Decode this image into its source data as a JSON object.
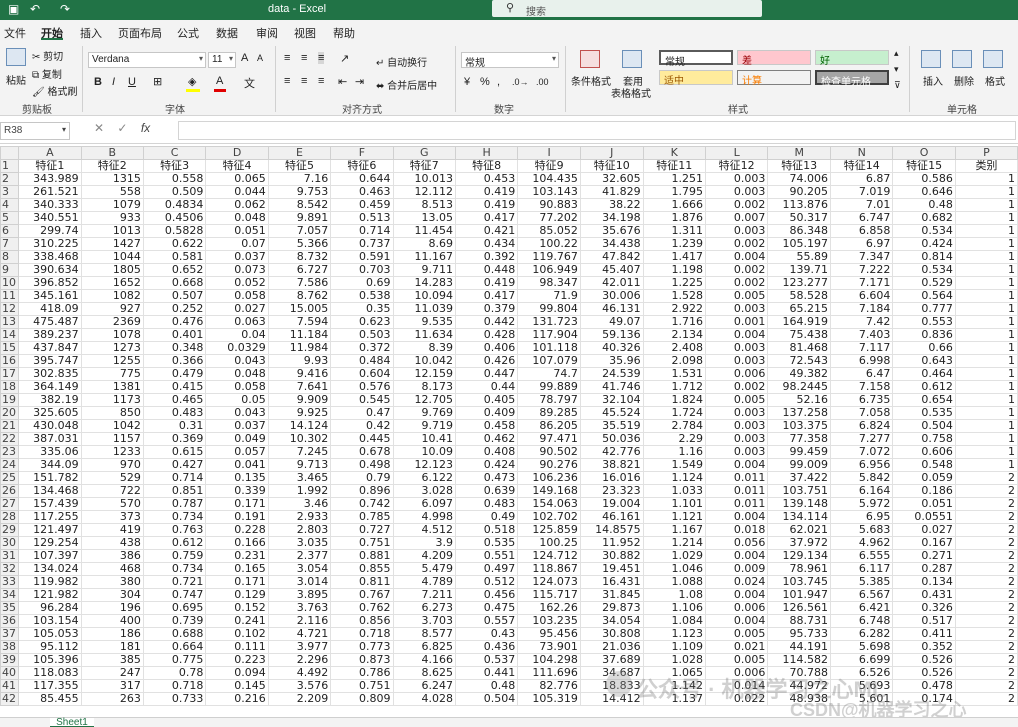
{
  "titlebar": {
    "title": "data  -  Excel",
    "search_placeholder": "搜索",
    "undo": "↶",
    "redo": "↷",
    "save": "▣"
  },
  "tabs": [
    "文件",
    "开始",
    "插入",
    "页面布局",
    "公式",
    "数据",
    "审阅",
    "视图",
    "帮助"
  ],
  "ribbon": {
    "paste": "粘贴",
    "cut": "剪切",
    "copy": "复制",
    "format_painter": "格式刷",
    "clipboard": "剪贴板",
    "font_name": "Verdana",
    "font_size": "11",
    "font_group": "字体",
    "bold": "B",
    "italic": "I",
    "underline": "U",
    "wrap": "自动换行",
    "merge": "合并后居中",
    "align_group": "对齐方式",
    "number_format": "常规",
    "percent": "%",
    "comma": ",",
    "number_group": "数字",
    "cond_format": "条件格式",
    "table_format_1": "套用",
    "table_format_2": "表格格式",
    "styles": {
      "normal": "常规",
      "bad": "差",
      "good": "好",
      "neutral": "适中",
      "calc": "计算",
      "check": "检查单元格"
    },
    "styles_group": "样式",
    "insert": "插入",
    "delete": "删除",
    "format": "格式",
    "cells_group": "单元格"
  },
  "formula": {
    "name_box": "R38",
    "fx": "fx",
    "cancel": "✕",
    "enter": "✓"
  },
  "columns": [
    "A",
    "B",
    "C",
    "D",
    "E",
    "F",
    "G",
    "H",
    "I",
    "J",
    "K",
    "L",
    "M",
    "N",
    "O",
    "P"
  ],
  "header_row": [
    "特征1",
    "特征2",
    "特征3",
    "特征4",
    "特征5",
    "特征6",
    "特征7",
    "特征8",
    "特征9",
    "特征10",
    "特征11",
    "特征12",
    "特征13",
    "特征14",
    "特征15",
    "类别"
  ],
  "rows": [
    [
      "343.989",
      "1315",
      "0.558",
      "0.065",
      "7.16",
      "0.644",
      "10.013",
      "0.453",
      "104.435",
      "32.605",
      "1.251",
      "0.003",
      "74.006",
      "6.87",
      "0.586",
      "1"
    ],
    [
      "261.521",
      "558",
      "0.509",
      "0.044",
      "9.753",
      "0.463",
      "12.112",
      "0.419",
      "103.143",
      "41.829",
      "1.795",
      "0.003",
      "90.205",
      "7.019",
      "0.646",
      "1"
    ],
    [
      "340.333",
      "1079",
      "0.4834",
      "0.062",
      "8.542",
      "0.459",
      "8.513",
      "0.419",
      "90.883",
      "38.22",
      "1.666",
      "0.002",
      "113.876",
      "7.01",
      "0.48",
      "1"
    ],
    [
      "340.551",
      "933",
      "0.4506",
      "0.048",
      "9.891",
      "0.513",
      "13.05",
      "0.417",
      "77.202",
      "34.198",
      "1.876",
      "0.007",
      "50.317",
      "6.747",
      "0.682",
      "1"
    ],
    [
      "299.74",
      "1013",
      "0.5828",
      "0.051",
      "7.057",
      "0.714",
      "11.454",
      "0.421",
      "85.052",
      "35.676",
      "1.311",
      "0.003",
      "86.348",
      "6.858",
      "0.534",
      "1"
    ],
    [
      "310.225",
      "1427",
      "0.622",
      "0.07",
      "5.366",
      "0.737",
      "8.69",
      "0.434",
      "100.22",
      "34.438",
      "1.239",
      "0.002",
      "105.197",
      "6.97",
      "0.424",
      "1"
    ],
    [
      "338.468",
      "1044",
      "0.581",
      "0.037",
      "8.732",
      "0.591",
      "11.167",
      "0.392",
      "119.767",
      "47.842",
      "1.417",
      "0.004",
      "55.89",
      "7.347",
      "0.814",
      "1"
    ],
    [
      "390.634",
      "1805",
      "0.652",
      "0.073",
      "6.727",
      "0.703",
      "9.711",
      "0.448",
      "106.949",
      "45.407",
      "1.198",
      "0.002",
      "139.71",
      "7.222",
      "0.534",
      "1"
    ],
    [
      "396.852",
      "1652",
      "0.668",
      "0.052",
      "7.586",
      "0.69",
      "14.283",
      "0.419",
      "98.347",
      "42.011",
      "1.225",
      "0.002",
      "123.277",
      "7.171",
      "0.529",
      "1"
    ],
    [
      "345.161",
      "1082",
      "0.507",
      "0.058",
      "8.762",
      "0.538",
      "10.094",
      "0.417",
      "71.9",
      "30.006",
      "1.528",
      "0.005",
      "58.528",
      "6.604",
      "0.564",
      "1"
    ],
    [
      "418.09",
      "927",
      "0.252",
      "0.027",
      "15.005",
      "0.35",
      "11.039",
      "0.379",
      "99.804",
      "46.131",
      "2.922",
      "0.003",
      "65.215",
      "7.184",
      "0.777",
      "1"
    ],
    [
      "475.487",
      "2369",
      "0.476",
      "0.063",
      "7.594",
      "0.623",
      "9.535",
      "0.442",
      "131.723",
      "49.07",
      "1.716",
      "0.001",
      "164.919",
      "7.42",
      "0.553",
      "1"
    ],
    [
      "389.237",
      "1078",
      "0.401",
      "0.04",
      "11.184",
      "0.503",
      "11.634",
      "0.428",
      "117.904",
      "59.136",
      "2.134",
      "0.004",
      "75.438",
      "7.403",
      "0.836",
      "1"
    ],
    [
      "437.847",
      "1273",
      "0.348",
      "0.0329",
      "11.984",
      "0.372",
      "8.39",
      "0.406",
      "101.118",
      "40.326",
      "2.408",
      "0.003",
      "81.468",
      "7.117",
      "0.66",
      "1"
    ],
    [
      "395.747",
      "1255",
      "0.366",
      "0.043",
      "9.93",
      "0.484",
      "10.042",
      "0.426",
      "107.079",
      "35.96",
      "2.098",
      "0.003",
      "72.543",
      "6.998",
      "0.643",
      "1"
    ],
    [
      "302.835",
      "775",
      "0.479",
      "0.048",
      "9.416",
      "0.604",
      "12.159",
      "0.447",
      "74.7",
      "24.539",
      "1.531",
      "0.006",
      "49.382",
      "6.47",
      "0.464",
      "1"
    ],
    [
      "364.149",
      "1381",
      "0.415",
      "0.058",
      "7.641",
      "0.576",
      "8.173",
      "0.44",
      "99.889",
      "41.746",
      "1.712",
      "0.002",
      "98.2445",
      "7.158",
      "0.612",
      "1"
    ],
    [
      "382.19",
      "1173",
      "0.465",
      "0.05",
      "9.909",
      "0.545",
      "12.705",
      "0.405",
      "78.797",
      "32.104",
      "1.824",
      "0.005",
      "52.16",
      "6.735",
      "0.654",
      "1"
    ],
    [
      "325.605",
      "850",
      "0.483",
      "0.043",
      "9.925",
      "0.47",
      "9.769",
      "0.409",
      "89.285",
      "45.524",
      "1.724",
      "0.003",
      "137.258",
      "7.058",
      "0.535",
      "1"
    ],
    [
      "430.048",
      "1042",
      "0.31",
      "0.037",
      "14.124",
      "0.42",
      "9.719",
      "0.458",
      "86.205",
      "35.519",
      "2.784",
      "0.003",
      "103.375",
      "6.824",
      "0.504",
      "1"
    ],
    [
      "387.031",
      "1157",
      "0.369",
      "0.049",
      "10.302",
      "0.445",
      "10.41",
      "0.462",
      "97.471",
      "50.036",
      "2.29",
      "0.003",
      "77.358",
      "7.277",
      "0.758",
      "1"
    ],
    [
      "335.06",
      "1233",
      "0.615",
      "0.057",
      "7.245",
      "0.678",
      "10.09",
      "0.408",
      "90.502",
      "42.776",
      "1.16",
      "0.003",
      "99.459",
      "7.072",
      "0.606",
      "1"
    ],
    [
      "344.09",
      "970",
      "0.427",
      "0.041",
      "9.713",
      "0.498",
      "12.123",
      "0.424",
      "90.276",
      "38.821",
      "1.549",
      "0.004",
      "99.009",
      "6.956",
      "0.548",
      "1"
    ],
    [
      "151.782",
      "529",
      "0.714",
      "0.135",
      "3.465",
      "0.79",
      "6.122",
      "0.473",
      "106.236",
      "16.016",
      "1.124",
      "0.011",
      "37.422",
      "5.842",
      "0.059",
      "2"
    ],
    [
      "134.468",
      "722",
      "0.851",
      "0.339",
      "1.992",
      "0.896",
      "3.028",
      "0.639",
      "149.168",
      "23.323",
      "1.033",
      "0.011",
      "103.751",
      "6.164",
      "0.186",
      "2"
    ],
    [
      "157.439",
      "570",
      "0.787",
      "0.171",
      "3.46",
      "0.742",
      "6.097",
      "0.483",
      "154.063",
      "19.004",
      "1.101",
      "0.011",
      "139.148",
      "5.972",
      "0.051",
      "2"
    ],
    [
      "117.255",
      "373",
      "0.734",
      "0.191",
      "2.933",
      "0.785",
      "4.998",
      "0.49",
      "102.702",
      "46.161",
      "1.121",
      "0.004",
      "134.114",
      "6.95",
      "0.0551",
      "2"
    ],
    [
      "121.497",
      "419",
      "0.763",
      "0.228",
      "2.803",
      "0.727",
      "4.512",
      "0.518",
      "125.859",
      "14.8575",
      "1.167",
      "0.018",
      "62.021",
      "5.683",
      "0.027",
      "2"
    ],
    [
      "129.254",
      "438",
      "0.612",
      "0.166",
      "3.035",
      "0.751",
      "3.9",
      "0.535",
      "100.25",
      "11.952",
      "1.214",
      "0.056",
      "37.972",
      "4.962",
      "0.167",
      "2"
    ],
    [
      "107.397",
      "386",
      "0.759",
      "0.231",
      "2.377",
      "0.881",
      "4.209",
      "0.551",
      "124.712",
      "30.882",
      "1.029",
      "0.004",
      "129.134",
      "6.555",
      "0.271",
      "2"
    ],
    [
      "134.024",
      "468",
      "0.734",
      "0.165",
      "3.054",
      "0.855",
      "5.479",
      "0.497",
      "118.867",
      "19.451",
      "1.046",
      "0.009",
      "78.961",
      "6.117",
      "0.287",
      "2"
    ],
    [
      "119.982",
      "380",
      "0.721",
      "0.171",
      "3.014",
      "0.811",
      "4.789",
      "0.512",
      "124.073",
      "16.431",
      "1.088",
      "0.024",
      "103.745",
      "5.385",
      "0.134",
      "2"
    ],
    [
      "121.982",
      "304",
      "0.747",
      "0.129",
      "3.895",
      "0.767",
      "7.211",
      "0.456",
      "115.717",
      "31.845",
      "1.08",
      "0.004",
      "101.947",
      "6.567",
      "0.431",
      "2"
    ],
    [
      "96.284",
      "196",
      "0.695",
      "0.152",
      "3.763",
      "0.762",
      "6.273",
      "0.475",
      "162.26",
      "29.873",
      "1.106",
      "0.006",
      "126.561",
      "6.421",
      "0.326",
      "2"
    ],
    [
      "103.154",
      "400",
      "0.739",
      "0.241",
      "2.116",
      "0.856",
      "3.703",
      "0.557",
      "103.235",
      "34.054",
      "1.084",
      "0.004",
      "88.731",
      "6.748",
      "0.517",
      "2"
    ],
    [
      "105.053",
      "186",
      "0.688",
      "0.102",
      "4.721",
      "0.718",
      "8.577",
      "0.43",
      "95.456",
      "30.808",
      "1.123",
      "0.005",
      "95.733",
      "6.282",
      "0.411",
      "2"
    ],
    [
      "95.112",
      "181",
      "0.664",
      "0.111",
      "3.977",
      "0.773",
      "6.825",
      "0.436",
      "73.901",
      "21.036",
      "1.109",
      "0.021",
      "44.191",
      "5.698",
      "0.352",
      "2"
    ],
    [
      "105.396",
      "385",
      "0.775",
      "0.223",
      "2.296",
      "0.873",
      "4.166",
      "0.537",
      "104.298",
      "37.689",
      "1.028",
      "0.005",
      "114.582",
      "6.699",
      "0.526",
      "2"
    ],
    [
      "118.083",
      "247",
      "0.78",
      "0.094",
      "4.492",
      "0.786",
      "8.625",
      "0.441",
      "111.696",
      "34.687",
      "1.065",
      "0.006",
      "70.788",
      "6.526",
      "0.526",
      "2"
    ],
    [
      "117.355",
      "317",
      "0.718",
      "0.145",
      "3.576",
      "0.751",
      "6.247",
      "0.48",
      "82.776",
      "18.833",
      "1.142",
      "0.014",
      "44.972",
      "5.693",
      "0.478",
      "2"
    ],
    [
      "85.455",
      "263",
      "0.733",
      "0.216",
      "2.209",
      "0.809",
      "4.028",
      "0.504",
      "105.319",
      "14.412",
      "1.137",
      "0.022",
      "48.938",
      "5.601",
      "0.174",
      "2"
    ]
  ],
  "sheet_tab": "Sheet1",
  "watermark": {
    "left": "公众号 · 机器学习之心ML",
    "right": "CSDN@机器学习之心"
  }
}
